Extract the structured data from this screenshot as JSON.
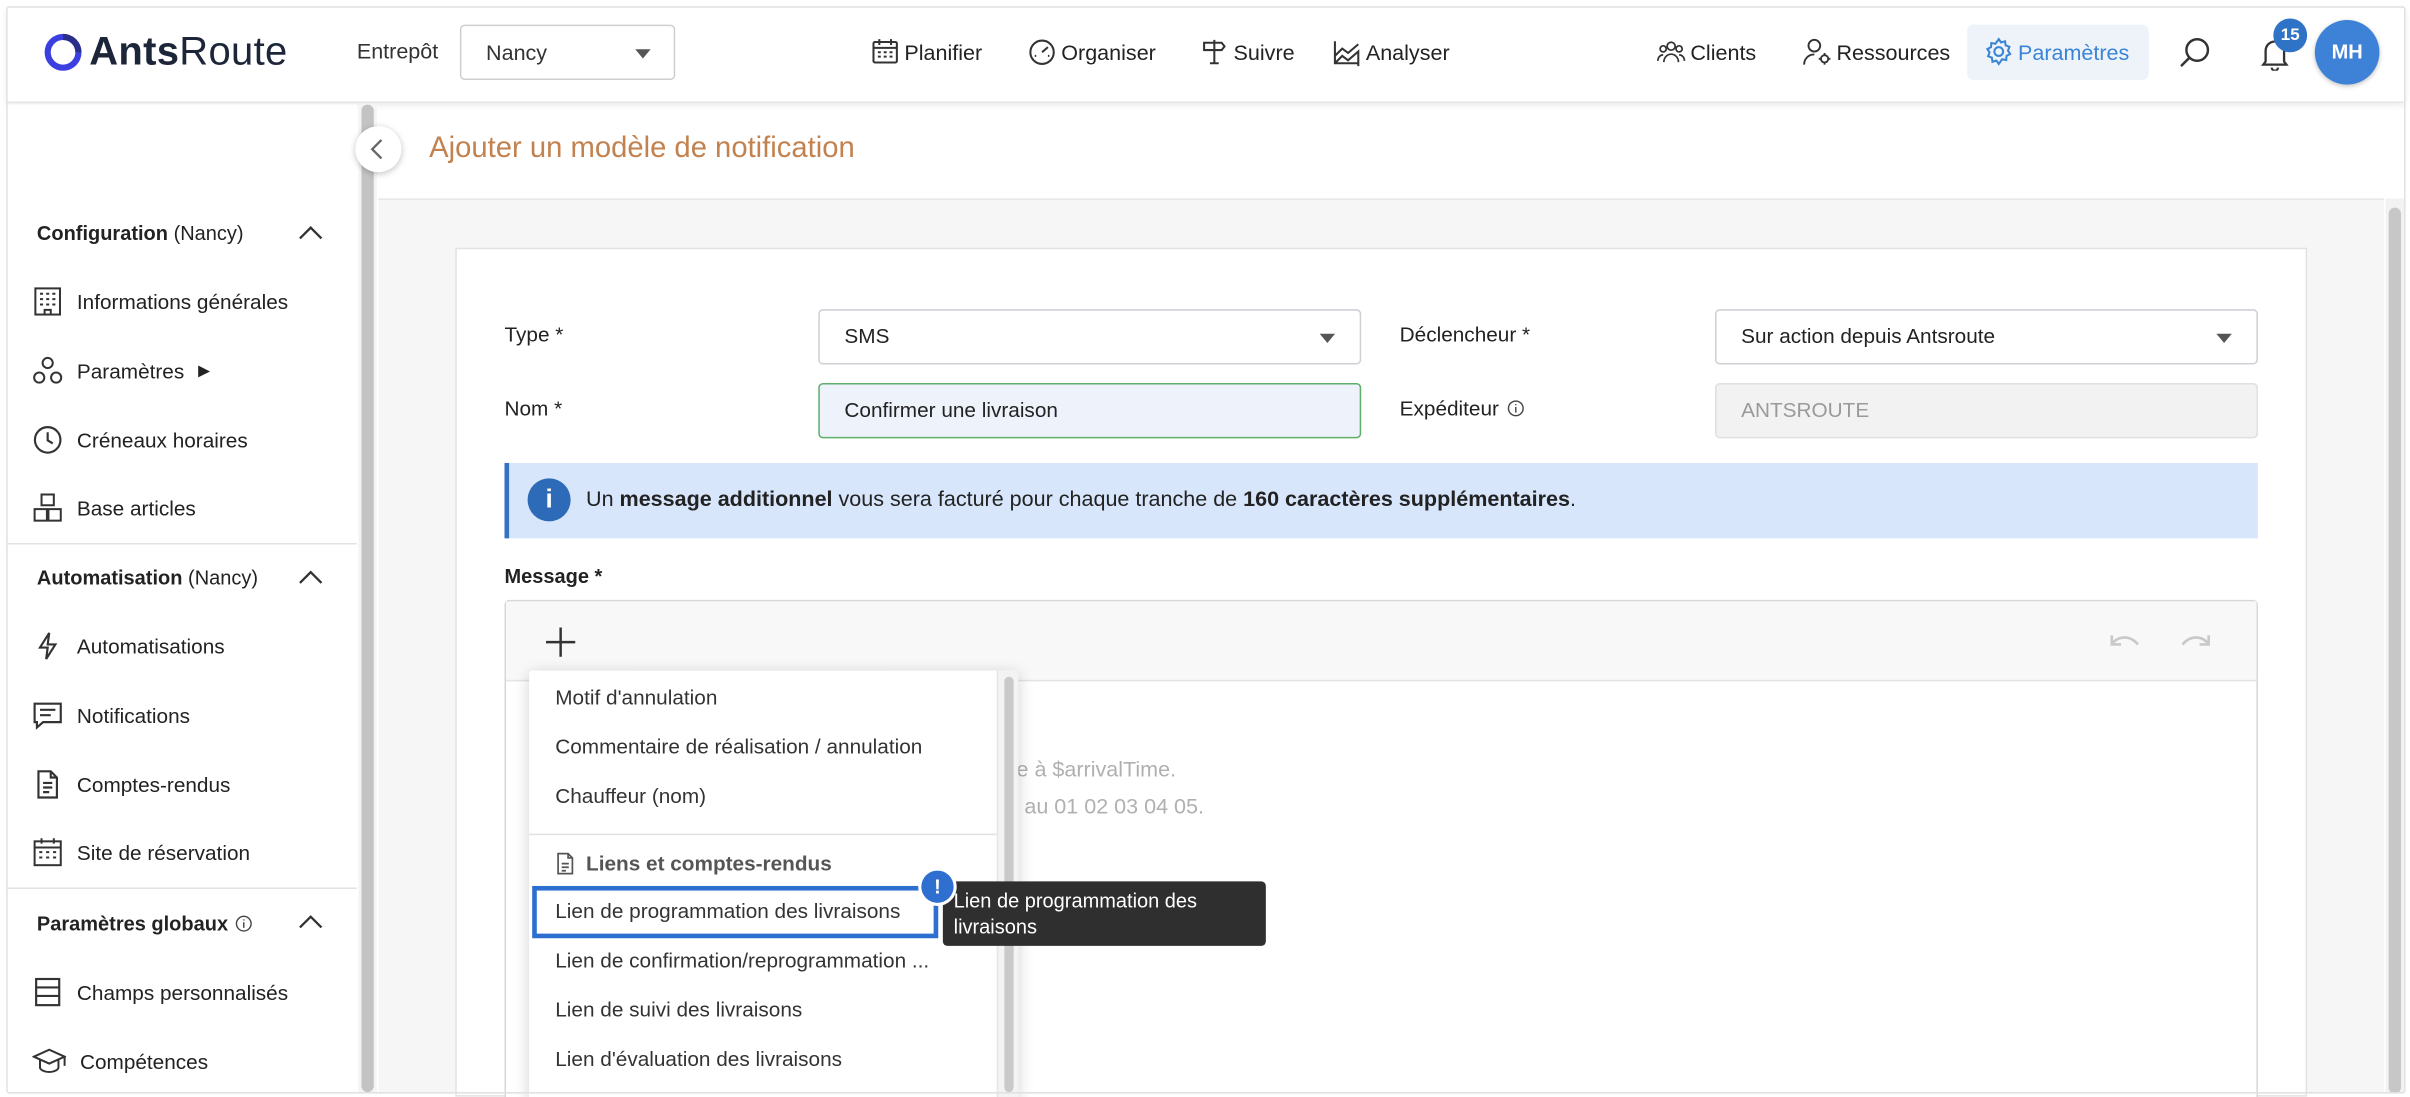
{
  "brand": {
    "name_bold": "Ants",
    "name_light": "Route"
  },
  "header": {
    "warehouse_label": "Entrepôt",
    "warehouse_value": "Nancy",
    "nav": {
      "plan": "Planifier",
      "organize": "Organiser",
      "track": "Suivre",
      "analyze": "Analyser"
    },
    "right_nav": {
      "clients": "Clients",
      "resources": "Ressources",
      "settings": "Paramètres"
    },
    "notifications_count": "15",
    "user_initials": "MH",
    "accent_color": "#2f73c7"
  },
  "sidebar": {
    "config_title": "Configuration",
    "config_scope": "(Nancy)",
    "config_items": {
      "general": "Informations générales",
      "params": "Paramètres",
      "params_arrow": "▶",
      "slots": "Créneaux horaires",
      "articles": "Base articles"
    },
    "auto_title": "Automatisation",
    "auto_scope": "(Nancy)",
    "auto_items": {
      "automations": "Automatisations",
      "notifications": "Notifications",
      "reports": "Comptes-rendus",
      "booking": "Site de réservation"
    },
    "global_title": "Paramètres globaux",
    "global_items": {
      "fields": "Champs personnalisés",
      "skills": "Compétences"
    }
  },
  "page": {
    "title": "Ajouter un modèle de notification",
    "title_color": "#c2824f"
  },
  "form": {
    "type_label": "Type *",
    "type_value": "SMS",
    "trigger_label": "Déclencheur *",
    "trigger_value": "Sur action depuis Antsroute",
    "name_label": "Nom *",
    "name_value": "Confirmer une livraison",
    "sender_label": "Expéditeur",
    "sender_value": "ANTSROUTE",
    "info": {
      "p1": "Un ",
      "b1": "message additionnel",
      "p2": " vous sera facturé pour chaque tranche de ",
      "b2": "160 caractères supplémentaires",
      "p3": "."
    },
    "message_label": "Message *",
    "message_line1": "te à $arrivalTime.",
    "message_line2": "au 01 02 03 04 05."
  },
  "variables_menu": {
    "items_top": [
      "Motif d'annulation",
      "Commentaire de réalisation / annulation",
      "Chauffeur (nom)"
    ],
    "group_label": "Liens et comptes-rendus",
    "highlighted": "Lien de programmation des livraisons",
    "items_bottom": [
      "Lien de confirmation/reprogrammation ...",
      "Lien de suivi des livraisons",
      "Lien d'évaluation des livraisons"
    ],
    "tooltip": "Lien de programmation des livraisons",
    "alert_mark": "!"
  }
}
